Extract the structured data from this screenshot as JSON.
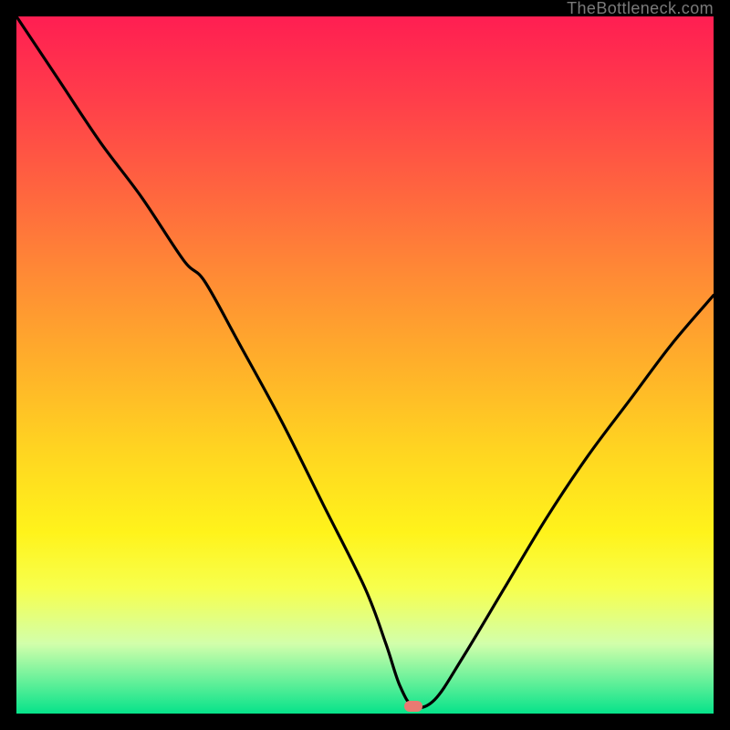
{
  "watermark": {
    "text": "TheBottleneck.com"
  },
  "colors": {
    "page_bg": "#000000",
    "curve": "#000000",
    "marker": "#e97a72",
    "gradient_top": "#ff1e52",
    "gradient_bottom": "#06e38a",
    "watermark": "#7a7a7a"
  },
  "chart_data": {
    "type": "line",
    "title": "",
    "xlabel": "",
    "ylabel": "",
    "xlim": [
      0,
      100
    ],
    "ylim": [
      0,
      100
    ],
    "annotations": [
      {
        "kind": "optimum_marker",
        "x": 57,
        "y": 1
      }
    ],
    "series": [
      {
        "name": "bottleneck-curve",
        "x": [
          0,
          6,
          12,
          18,
          24,
          27,
          32,
          38,
          44,
          50,
          53,
          55,
          57,
          60,
          64,
          70,
          76,
          82,
          88,
          94,
          100
        ],
        "values": [
          100,
          91,
          82,
          74,
          65,
          62,
          53,
          42,
          30,
          18,
          10,
          4,
          1,
          2,
          8,
          18,
          28,
          37,
          45,
          53,
          60
        ]
      }
    ]
  }
}
